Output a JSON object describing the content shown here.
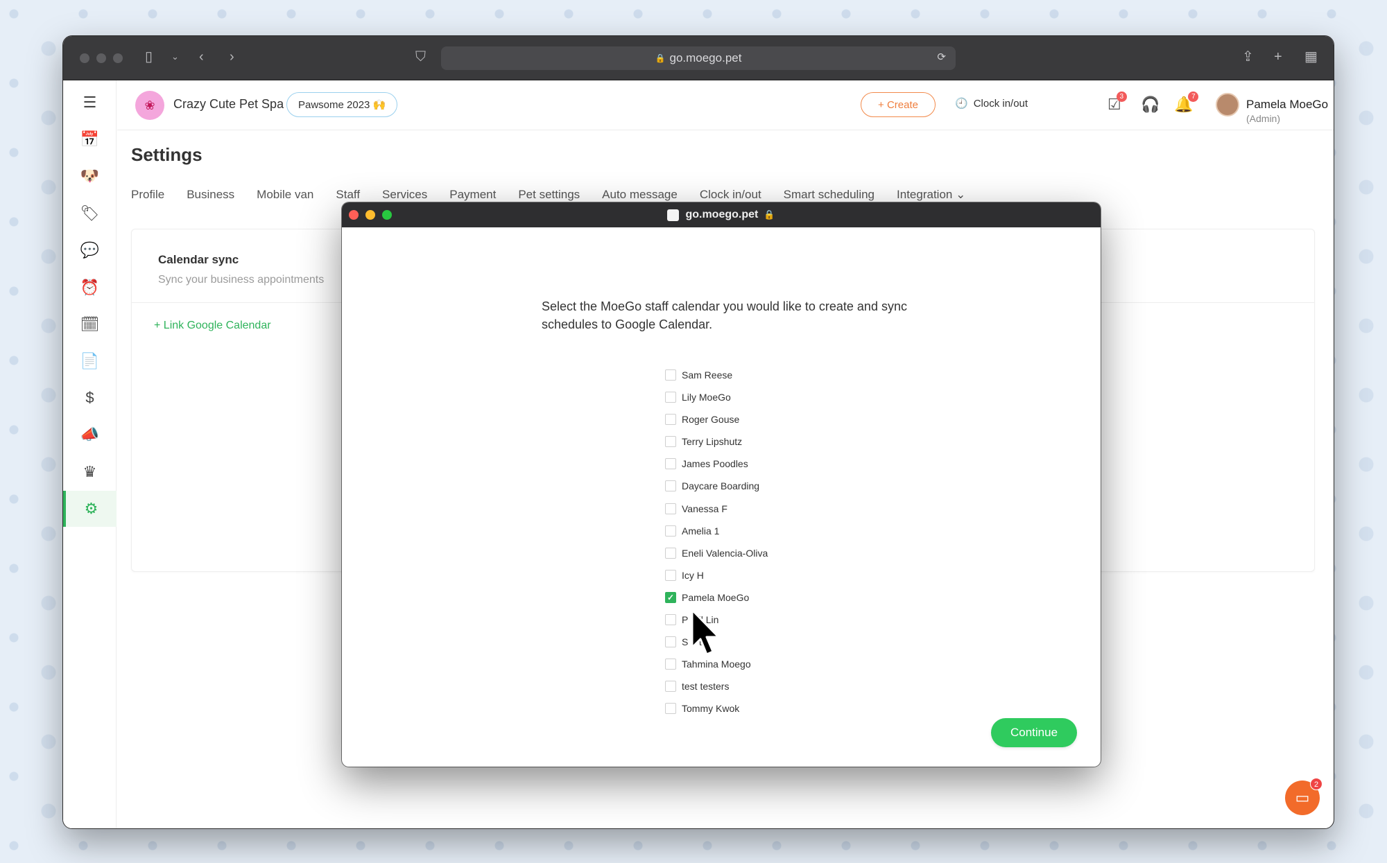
{
  "browser": {
    "url": "go.moego.pet",
    "lock_glyph": "🔒",
    "colors": {
      "toolbar": "#3a3a3c"
    }
  },
  "header": {
    "business_name": "Crazy Cute Pet Spa",
    "badge_label": "Pawsome 2023 🙌",
    "create_label": "+ Create",
    "clock_label": "Clock in/out",
    "task_count": "3",
    "notification_count": "7",
    "user_name": "Pamela MoeGo",
    "user_role": "(Admin)"
  },
  "settings": {
    "title": "Settings",
    "tabs": [
      "Profile",
      "Business",
      "Mobile van",
      "Staff",
      "Services",
      "Payment",
      "Pet settings",
      "Auto message",
      "Clock in/out",
      "Smart scheduling",
      "Integration"
    ],
    "card": {
      "title": "Calendar sync",
      "subtitle": "Sync your business appointments",
      "link_label": "+ Link Google Calendar"
    }
  },
  "popup": {
    "title": "go.moego.pet",
    "message": "Select the MoeGo staff calendar you would like to create and sync schedules to Google Calendar.",
    "staff": [
      {
        "name": "Sam Reese",
        "checked": false
      },
      {
        "name": "Lily MoeGo",
        "checked": false
      },
      {
        "name": "Roger Gouse",
        "checked": false
      },
      {
        "name": "Terry Lipshutz",
        "checked": false
      },
      {
        "name": "James Poodles",
        "checked": false
      },
      {
        "name": "Daycare Boarding",
        "checked": false
      },
      {
        "name": "Vanessa F",
        "checked": false
      },
      {
        "name": "Amelia 1",
        "checked": false
      },
      {
        "name": "Eneli Valencia-Oliva",
        "checked": false
      },
      {
        "name": "Icy H",
        "checked": false
      },
      {
        "name": "Pamela MoeGo",
        "checked": true
      },
      {
        "name": "P    ll Lin",
        "checked": false
      },
      {
        "name": "S    th",
        "checked": false
      },
      {
        "name": "Tahmina Moego",
        "checked": false
      },
      {
        "name": "test testers",
        "checked": false
      },
      {
        "name": "Tommy Kwok",
        "checked": false
      }
    ],
    "continue_label": "Continue"
  },
  "chat": {
    "badge": "2"
  },
  "colors": {
    "accent": "#2fb35b",
    "create": "#ef7e3d",
    "continue": "#2fcb5e"
  }
}
